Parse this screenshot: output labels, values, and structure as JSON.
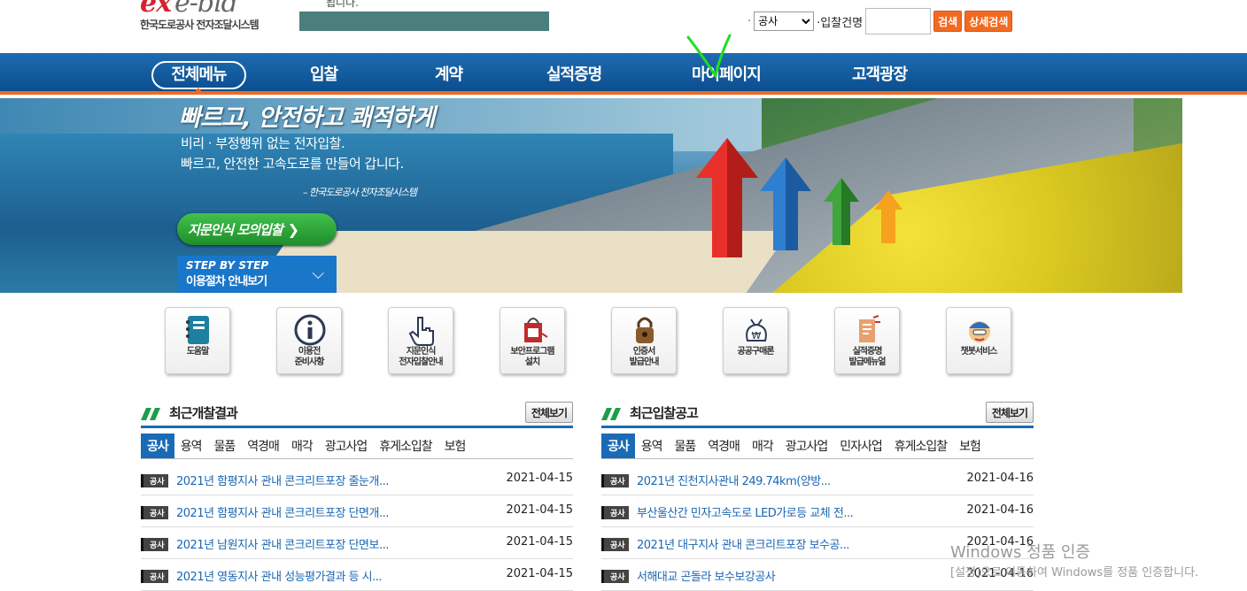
{
  "header": {
    "logo_mark": "ex",
    "logo_mark2": "e-bid",
    "logo_sub": "한국도로공사 전자조달시스템",
    "message": "됩니다.",
    "search": {
      "dot": "·",
      "category_selected": "공사",
      "label": "·입찰건명",
      "input_value": "",
      "search_label": "검색",
      "detail_label": "상세검색"
    }
  },
  "nav": {
    "all_menu": "전체메뉴",
    "items": [
      "입찰",
      "계약",
      "실적증명",
      "마이페이지",
      "고객광장"
    ]
  },
  "banner": {
    "title": "빠르고, 안전하고 쾌적하게",
    "line1": "비리 · 부정행위 없는 전자입찰.",
    "line2": "빠르고, 안전한 고속도로를 만들어 갑니다.",
    "signature": "– 한국도로공사 전자조달시스템",
    "btn_fingerprint": "지문인식 모의입찰",
    "btn_step_l1": "STEP BY STEP",
    "btn_step_l2": "이용절차 안내보기"
  },
  "quick_links": [
    {
      "label": "도움말",
      "icon": "notebook-icon"
    },
    {
      "label": "이용전\n준비사항",
      "icon": "info-icon"
    },
    {
      "label": "지문인식\n전자입찰안내",
      "icon": "pointing-hand-icon"
    },
    {
      "label": "보안프로그램\n설치",
      "icon": "security-tag-icon"
    },
    {
      "label": "인증서\n발급안내",
      "icon": "padlock-icon"
    },
    {
      "label": "공공구매론",
      "icon": "money-bag-icon"
    },
    {
      "label": "실적증명\n발급메뉴얼",
      "icon": "document-icon"
    },
    {
      "label": "챗봇서비스",
      "icon": "chatbot-icon"
    }
  ],
  "results": {
    "title": "최근개찰결과",
    "more": "전체보기",
    "tabs": [
      "공사",
      "용역",
      "물품",
      "역경매",
      "매각",
      "광고사업",
      "휴게소입찰",
      "보험"
    ],
    "rows": [
      {
        "badge": "공사",
        "title": "2021년 함평지사 관내 콘크리트포장 줄눈개...",
        "date": "2021-04-15"
      },
      {
        "badge": "공사",
        "title": "2021년 함평지사 관내 콘크리트포장 단면개...",
        "date": "2021-04-15"
      },
      {
        "badge": "공사",
        "title": "2021년 남원지사 관내 콘크리트포장 단면보...",
        "date": "2021-04-15"
      },
      {
        "badge": "공사",
        "title": "2021년 영동지사 관내 성능평가결과 등 시...",
        "date": "2021-04-15"
      }
    ]
  },
  "notices": {
    "title": "최근입찰공고",
    "more": "전체보기",
    "tabs": [
      "공사",
      "용역",
      "물품",
      "역경매",
      "매각",
      "광고사업",
      "민자사업",
      "휴게소입찰",
      "보험"
    ],
    "rows": [
      {
        "badge": "공사",
        "title": "2021년 진천지사관내 249.74km(양방...",
        "date": "2021-04-16"
      },
      {
        "badge": "공사",
        "title": "부산울산간 민자고속도로 LED가로등 교체 전...",
        "date": "2021-04-16"
      },
      {
        "badge": "공사",
        "title": "2021년 대구지사 관내 콘크리트포장 보수공...",
        "date": "2021-04-16"
      },
      {
        "badge": "공사",
        "title": "서해대교 곤돌라 보수보강공사",
        "date": "2021-04-16"
      }
    ]
  },
  "watermark": {
    "line1": "Windows 정품 인증",
    "line2": "[설정]으로 이동하여 Windows를 정품 인증합니다."
  },
  "colors": {
    "nav_blue": "#0b4f8f",
    "accent_orange": "#f26a21",
    "tab_blue": "#1a6bb5",
    "link_blue": "#1a66b3"
  }
}
